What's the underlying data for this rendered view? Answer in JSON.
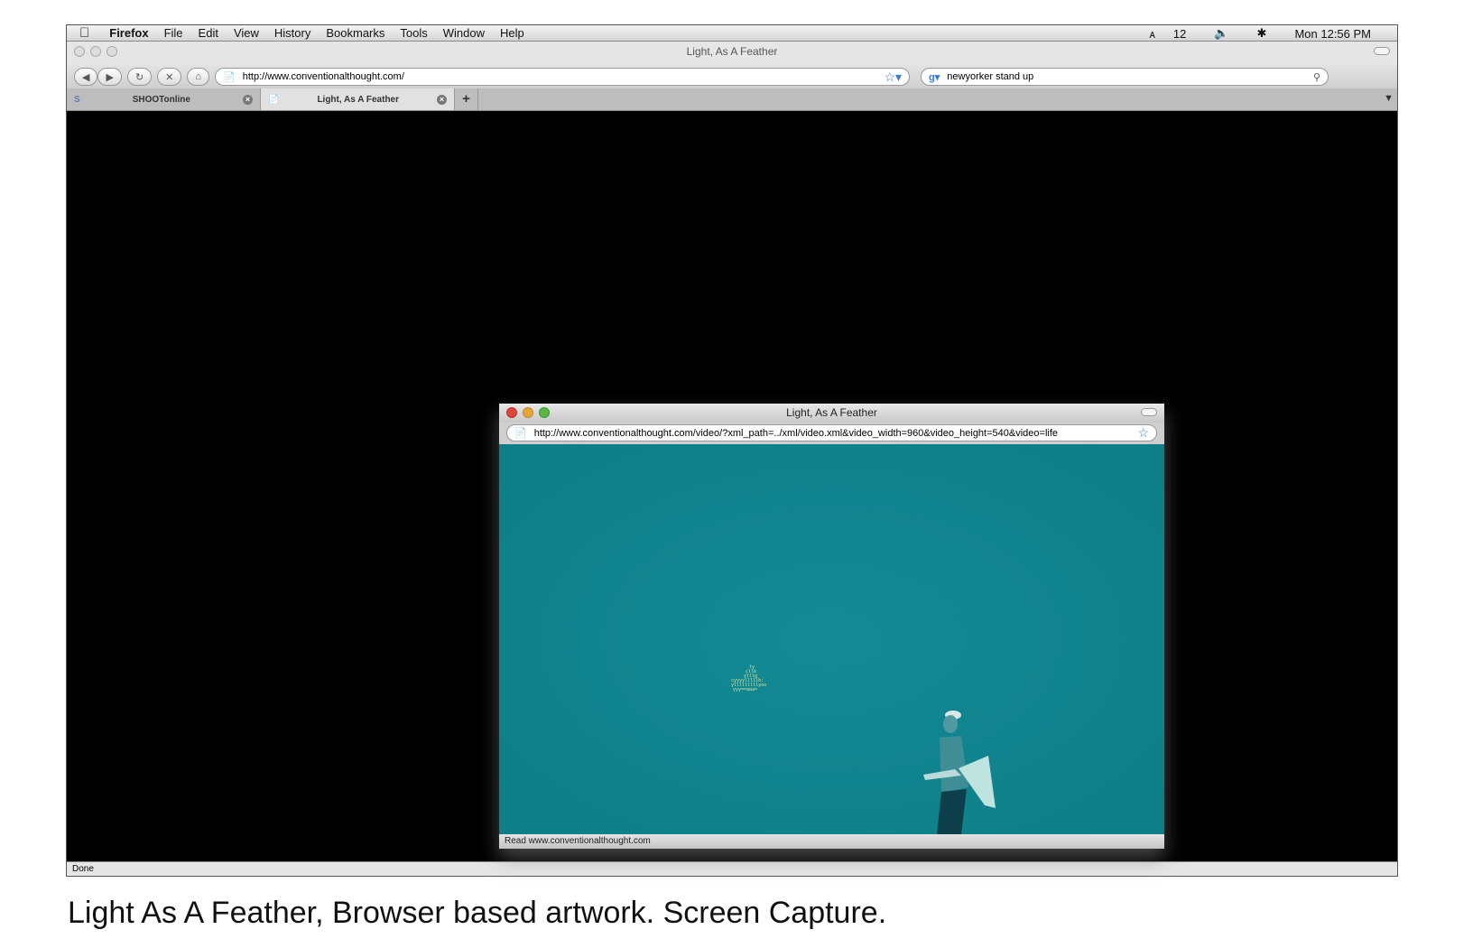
{
  "menubar": {
    "app": "Firefox",
    "items": [
      "File",
      "Edit",
      "View",
      "History",
      "Bookmarks",
      "Tools",
      "Window",
      "Help"
    ],
    "adobe_count": "12",
    "clock": "Mon 12:56 PM"
  },
  "window": {
    "title": "Light, As A Feather"
  },
  "toolbar": {
    "url": "http://www.conventionalthought.com/",
    "search": "newyorker stand up"
  },
  "tabs": [
    {
      "label": "SHOOTonline",
      "icon": "shoot-favicon-icon"
    },
    {
      "label": "Light, As A Feather",
      "icon": "page-icon"
    }
  ],
  "status": "Done",
  "popup": {
    "title": "Light, As A Feather",
    "url": "http://www.conventionalthought.com/video/?xml_path=../xml/video.xml&video_width=960&video_height=540&video=life",
    "status": "Read www.conventionalthought.com",
    "background": "#12868f"
  },
  "caption": "Light As A Feather, Browser based artwork. Screen Capture."
}
